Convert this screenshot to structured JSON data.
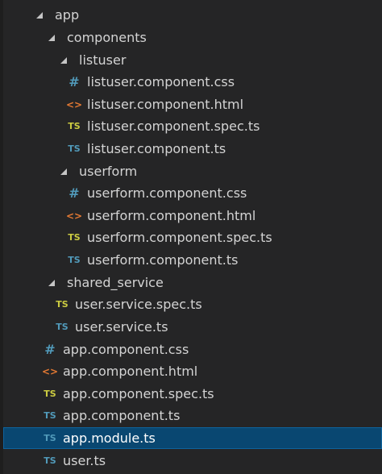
{
  "colors": {
    "background": "#252526",
    "selection": "#094771",
    "text": "#d4d4d4",
    "ts_test_icon": "#cbcb41",
    "ts_icon": "#519aba",
    "css_icon": "#519aba",
    "html_icon": "#e37933"
  },
  "tree": {
    "app": {
      "label": "app",
      "expanded": true,
      "icon": "chevron-down-icon"
    },
    "components": {
      "label": "components",
      "expanded": true,
      "icon": "chevron-down-icon"
    },
    "listuser": {
      "label": "listuser",
      "expanded": true,
      "icon": "chevron-down-icon",
      "files": [
        {
          "label": "listuser.component.css",
          "glyph": "#",
          "icon": "css-icon"
        },
        {
          "label": "listuser.component.html",
          "glyph": "<>",
          "icon": "html-icon"
        },
        {
          "label": "listuser.component.spec.ts",
          "glyph": "TS",
          "icon": "ts-test-icon"
        },
        {
          "label": "listuser.component.ts",
          "glyph": "TS",
          "icon": "ts-icon"
        }
      ]
    },
    "userform": {
      "label": "userform",
      "expanded": true,
      "icon": "chevron-down-icon",
      "files": [
        {
          "label": "userform.component.css",
          "glyph": "#",
          "icon": "css-icon"
        },
        {
          "label": "userform.component.html",
          "glyph": "<>",
          "icon": "html-icon"
        },
        {
          "label": "userform.component.spec.ts",
          "glyph": "TS",
          "icon": "ts-test-icon"
        },
        {
          "label": "userform.component.ts",
          "glyph": "TS",
          "icon": "ts-icon"
        }
      ]
    },
    "shared_service": {
      "label": "shared_service",
      "expanded": true,
      "icon": "chevron-down-icon",
      "files": [
        {
          "label": "user.service.spec.ts",
          "glyph": "TS",
          "icon": "ts-test-icon"
        },
        {
          "label": "user.service.ts",
          "glyph": "TS",
          "icon": "ts-icon"
        }
      ]
    },
    "app_files": [
      {
        "label": "app.component.css",
        "glyph": "#",
        "icon": "css-icon"
      },
      {
        "label": "app.component.html",
        "glyph": "<>",
        "icon": "html-icon"
      },
      {
        "label": "app.component.spec.ts",
        "glyph": "TS",
        "icon": "ts-test-icon"
      },
      {
        "label": "app.component.ts",
        "glyph": "TS",
        "icon": "ts-icon"
      },
      {
        "label": "app.module.ts",
        "glyph": "TS",
        "icon": "ts-icon",
        "selected": true
      },
      {
        "label": "user.ts",
        "glyph": "TS",
        "icon": "ts-icon"
      }
    ]
  }
}
